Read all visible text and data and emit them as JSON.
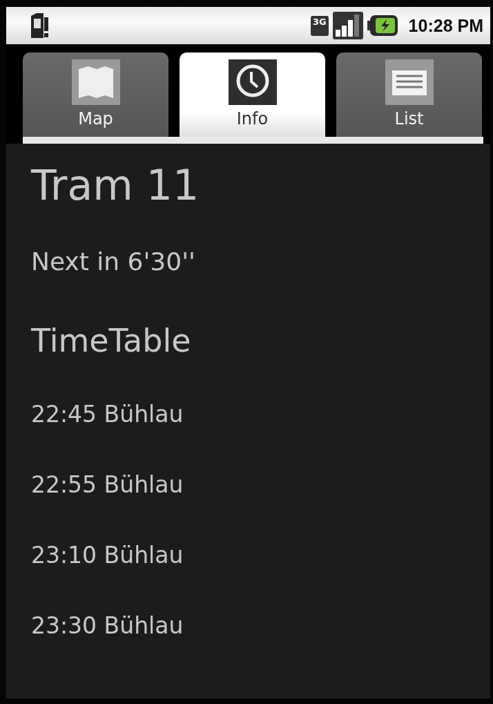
{
  "status_bar": {
    "network": "3G",
    "time": "10:28 PM"
  },
  "tabs": [
    {
      "label": "Map",
      "kind": "map",
      "selected": false
    },
    {
      "label": "Info",
      "kind": "clock",
      "selected": true
    },
    {
      "label": "List",
      "kind": "list",
      "selected": false
    }
  ],
  "title": "Tram 11",
  "next": "Next in 6'30''",
  "timetable_heading": "TimeTable",
  "departures": [
    "22:45 Bühlau",
    "22:55 Bühlau",
    "23:10 Bühlau",
    "23:30 Bühlau"
  ]
}
